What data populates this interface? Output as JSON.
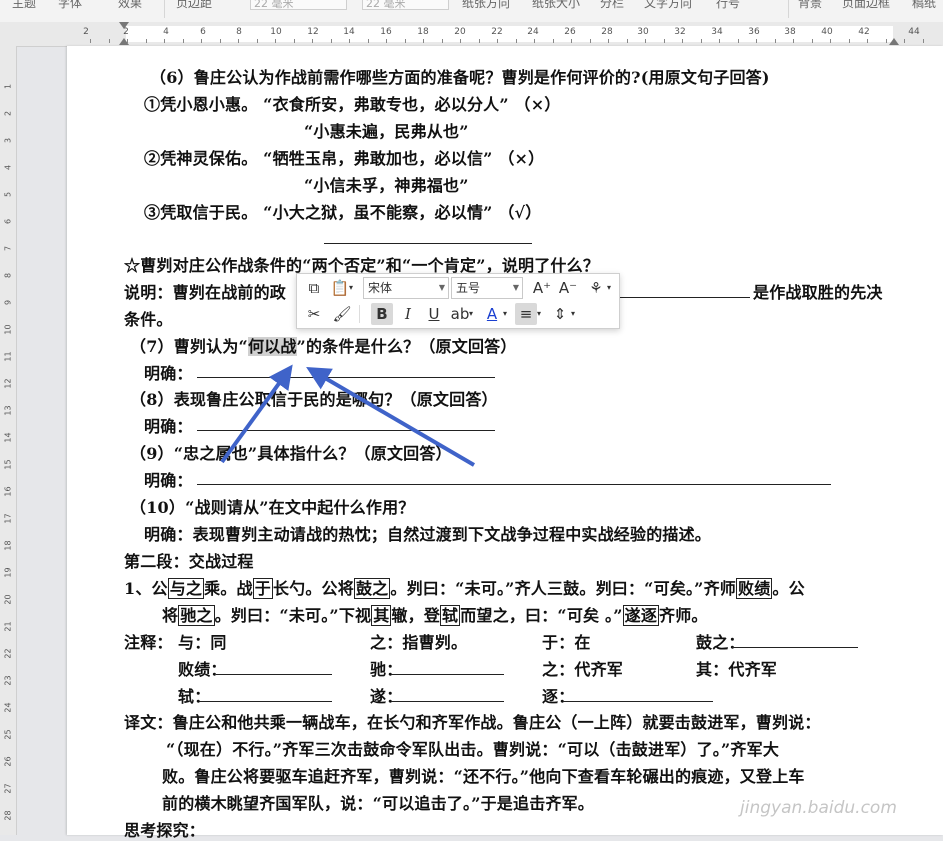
{
  "toolbar": {
    "items": [
      "主题",
      "字体",
      "效果",
      "页边距",
      "纸张方向",
      "纸张大小",
      "分栏",
      "文字方向",
      "行号",
      "背景",
      "页面边框",
      "稿纸"
    ],
    "fields": [
      "22 毫米",
      "22 毫米"
    ]
  },
  "ruler": {
    "h_numbers": [
      "2",
      "2",
      "4",
      "6",
      "8",
      "10",
      "12",
      "14",
      "16",
      "18",
      "20",
      "22",
      "24",
      "26",
      "28",
      "30",
      "32",
      "34",
      "36",
      "38",
      "40",
      "42",
      "44"
    ],
    "v_numbers": [
      "1",
      "2",
      "3",
      "4",
      "5",
      "6",
      "7",
      "8",
      "9",
      "10",
      "11",
      "12",
      "13",
      "14",
      "15",
      "16",
      "17",
      "18",
      "19",
      "20",
      "21",
      "22",
      "23",
      "24",
      "25",
      "26",
      "27",
      "28"
    ]
  },
  "doc": {
    "q6": "（6）鲁庄公认为作战前需作哪些方面的准备呢？曹刿是作何评价的?(用原文句子回答)",
    "q6_a1": "①凭小恩小惠。 “衣食所安，弗敢专也，必以分人” （×）",
    "q6_a1b": "“小惠未遍，民弗从也”",
    "q6_a2": "②凭神灵保佑。 “牺牲玉帛，弗敢加也，必以信” （×）",
    "q6_a2b": "“小信未孚，神弗福也”",
    "q6_a3": "③凭取信于民。 “小大之狱，虽不能察，必以情” （√）",
    "star_q": "☆曹刿对庄公作战条件的“两个否定”和“一个肯定”，说明了什么？",
    "explain_a": "说明：曹刿在战前的政",
    "explain_b": "是作战取胜的先决",
    "explain_c": "条件。",
    "q7_a": "（7）曹刿认为“",
    "q7_hl": "何以战",
    "q7_b": "”的条件是什么？（原文回答）",
    "ming": "明确：",
    "q8": "（8）表现鲁庄公取信于民的是哪句？（原文回答）",
    "q9": "（9）“忠之属也”具体指什么？（原文回答）",
    "q10": "（10）“战则请从”在文中起什么作用？",
    "q10_a": "明确：表现曹刿主动请战的热忱；自然过渡到下文战争过程中实战经验的描述。",
    "sec2": "第二段：交战过程",
    "p1_l1": [
      "1、公",
      "与之",
      "乘。战",
      "于",
      "长勺。公将",
      "鼓之",
      "。刿曰：“未可。”齐人三鼓。刿曰：“可矣。”齐师",
      "败绩",
      "。公"
    ],
    "p1_l2": [
      "将",
      "驰之",
      "。刿曰：“未可。”下视",
      "其",
      "辙，登",
      "轼",
      "而望之，曰：“可矣 。”",
      "遂逐",
      "齐师。"
    ],
    "notes_label": "注释：",
    "notes": {
      "yu": "与：同",
      "zhi1": "之：指曹刿。",
      "yu2": "于：在",
      "guzhi": "鼓之：",
      "baiji": "败绩：",
      "chi": "驰：",
      "zhi2": "之：代齐军",
      "qi": "其：代齐军",
      "shi": "轼：",
      "sui": "遂：",
      "zhu": "逐："
    },
    "trans_l1": "译文：鲁庄公和他共乘一辆战车，在长勺和齐军作战。鲁庄公（一上阵）就要击鼓进军，曹刿说：",
    "trans_l2": "“（现在）不行。”齐军三次击鼓命令军队出击。曹刿说：“可以（击鼓进军）了。”齐军大",
    "trans_l3": "败。鲁庄公将要驱车追赶齐军，曹刿说：“还不行。”他向下查看车轮碾出的痕迹，又登上车",
    "trans_l4": "前的横木眺望齐国军队，说：“可以追击了。”于是追击齐军。",
    "think": "思考探究："
  },
  "format_toolbar": {
    "font_name": "宋体",
    "font_size": "五号",
    "bold": "B",
    "italic": "I",
    "underline": "U"
  },
  "watermark": "jingyan.baidu.com",
  "colors": {
    "arrow": "#3f63c9",
    "highlight": "#d0d0d0",
    "text": "#111111"
  }
}
